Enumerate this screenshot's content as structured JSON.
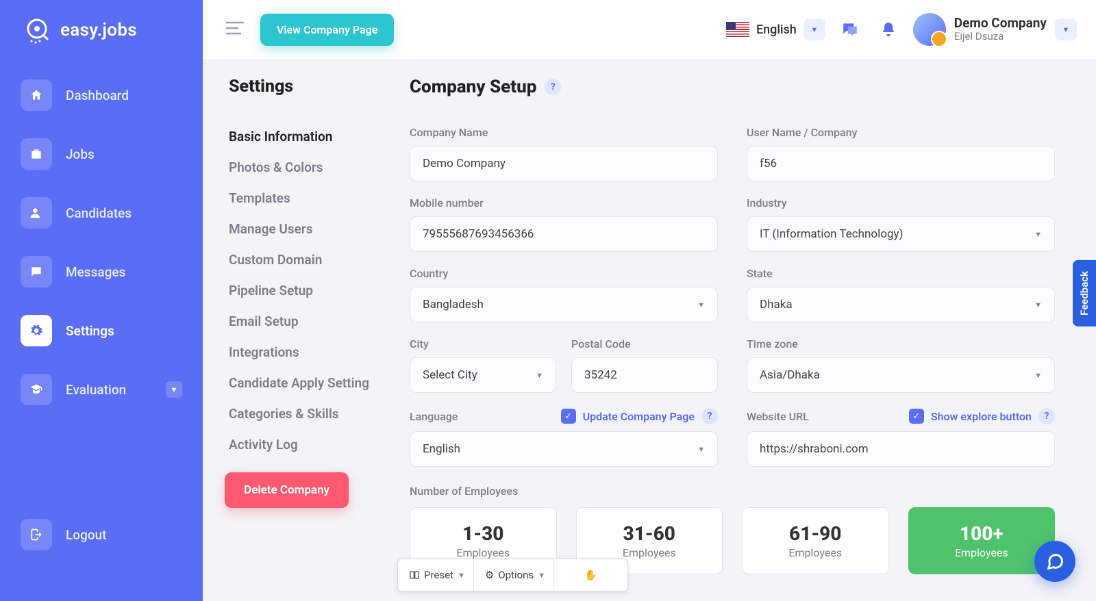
{
  "brand": "easy.jobs",
  "nav": {
    "items": [
      {
        "label": "Dashboard"
      },
      {
        "label": "Jobs"
      },
      {
        "label": "Candidates"
      },
      {
        "label": "Messages"
      },
      {
        "label": "Settings"
      },
      {
        "label": "Evaluation"
      }
    ],
    "logout": "Logout"
  },
  "topbar": {
    "view_btn": "View Company Page",
    "language": "English",
    "company": "Demo Company",
    "user": "Eijel Dsuza"
  },
  "settings": {
    "heading": "Settings",
    "items": [
      "Basic Information",
      "Photos & Colors",
      "Templates",
      "Manage Users",
      "Custom Domain",
      "Pipeline Setup",
      "Email Setup",
      "Integrations",
      "Candidate Apply Setting",
      "Categories & Skills",
      "Activity Log"
    ],
    "delete": "Delete Company"
  },
  "form": {
    "title": "Company Setup",
    "labels": {
      "company_name": "Company Name",
      "user_name": "User Name / Company",
      "mobile": "Mobile number",
      "industry": "Industry",
      "country": "Country",
      "state": "State",
      "city": "City",
      "postal": "Postal Code",
      "timezone": "Time zone",
      "language": "Language",
      "website": "Website URL",
      "employees": "Number of Employees"
    },
    "values": {
      "company_name": "Demo Company",
      "user_name": "f56",
      "mobile": "79555687693456366",
      "industry": "IT (Information Technology)",
      "country": "Bangladesh",
      "state": "Dhaka",
      "city": "Select City",
      "postal": "35242",
      "timezone": "Asia/Dhaka",
      "language": "English",
      "website": "https://shraboni.com"
    },
    "checks": {
      "update_page": "Update Company Page",
      "show_explore": "Show explore button"
    },
    "employees": {
      "options": [
        {
          "range": "1-30",
          "sub": "Employees"
        },
        {
          "range": "31-60",
          "sub": "Employees"
        },
        {
          "range": "61-90",
          "sub": "Employees"
        },
        {
          "range": "100+",
          "sub": "Employees"
        }
      ]
    }
  },
  "feedback": "Feedback",
  "bottom": {
    "preset": "Preset",
    "options": "Options"
  }
}
